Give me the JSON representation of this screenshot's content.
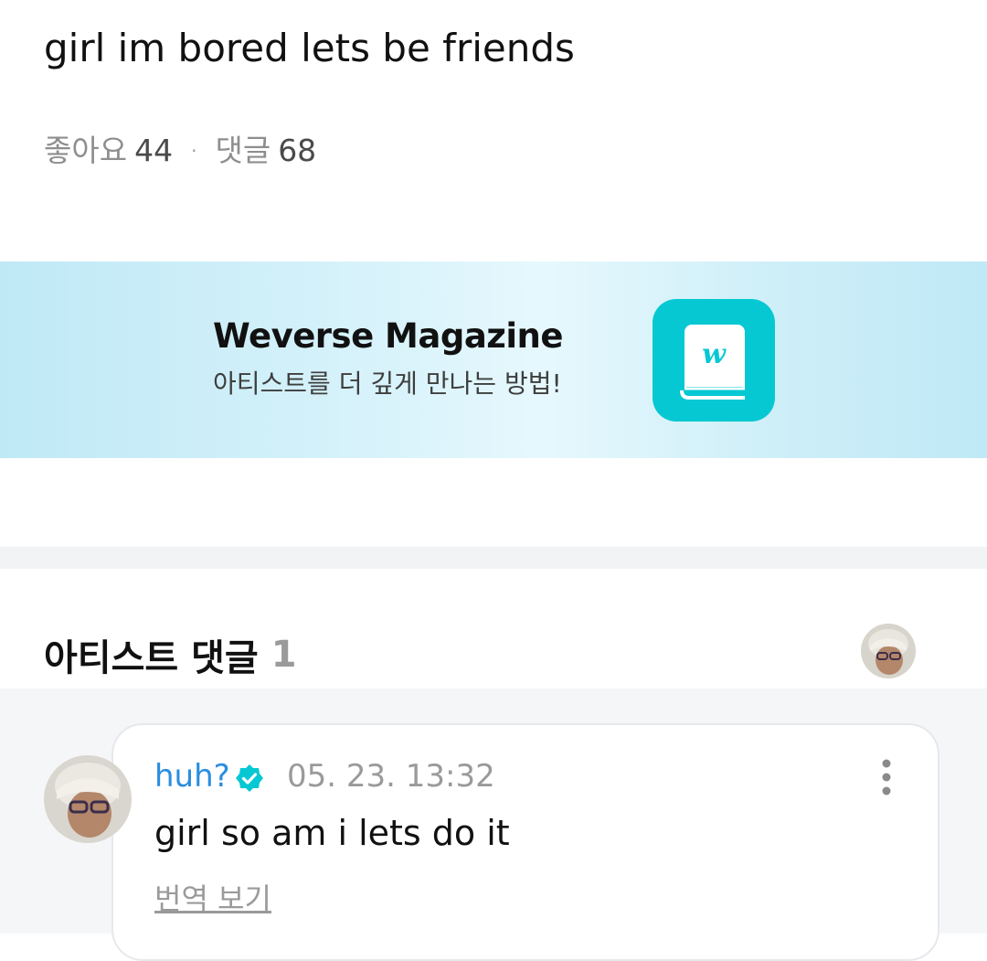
{
  "post": {
    "text": "girl im bored lets be friends",
    "likes_label": "좋아요",
    "likes_count": "44",
    "separator": "·",
    "comments_label": "댓글",
    "comments_count": "68"
  },
  "banner": {
    "title": "Weverse Magazine",
    "subtitle": "아티스트를 더 깊게 만나는 방법!",
    "icon": "weverse-book-icon",
    "icon_bg": "#06c8d3"
  },
  "artist_comments": {
    "title": "아티스트 댓글",
    "count": "1"
  },
  "comment": {
    "author": "huh?",
    "timestamp": "05. 23. 13:32",
    "text": "girl so am i lets do it",
    "translate_label": "번역 보기",
    "author_color": "#2a8ee0",
    "verified_color": "#06c8d3"
  }
}
